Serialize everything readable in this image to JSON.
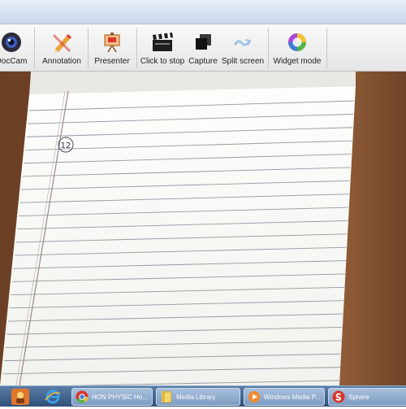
{
  "toolbar": {
    "items": [
      {
        "label": "DocCam",
        "icon": "webcam-icon"
      },
      {
        "label": "Annotation",
        "icon": "pencil-icon"
      },
      {
        "label": "Presenter",
        "icon": "presenter-easel-icon"
      },
      {
        "label": "Click to stop",
        "icon": "clapperboard-icon"
      },
      {
        "label": "Capture",
        "icon": "capture-icon"
      },
      {
        "label": "Split screen",
        "icon": "split-screen-icon"
      },
      {
        "label": "Widget mode",
        "icon": "color-wheel-icon"
      }
    ]
  },
  "paper": {
    "page_number": "12"
  },
  "taskbar": {
    "items": [
      {
        "label": "HON PHYSIC Ho...",
        "icon": "chrome-icon"
      },
      {
        "label": "Media Library",
        "icon": "folder-icon"
      },
      {
        "label": "Windows Media P...",
        "icon": "media-player-icon"
      },
      {
        "label": "Sphere",
        "icon": "sphere-app-icon"
      }
    ]
  },
  "colors": {
    "desk": "#7a4a2c",
    "paper": "#fbfbf8",
    "rule_line": "#8f9aa4",
    "margin_line": "#9a8a8a",
    "taskbar": "#2f4f78"
  }
}
